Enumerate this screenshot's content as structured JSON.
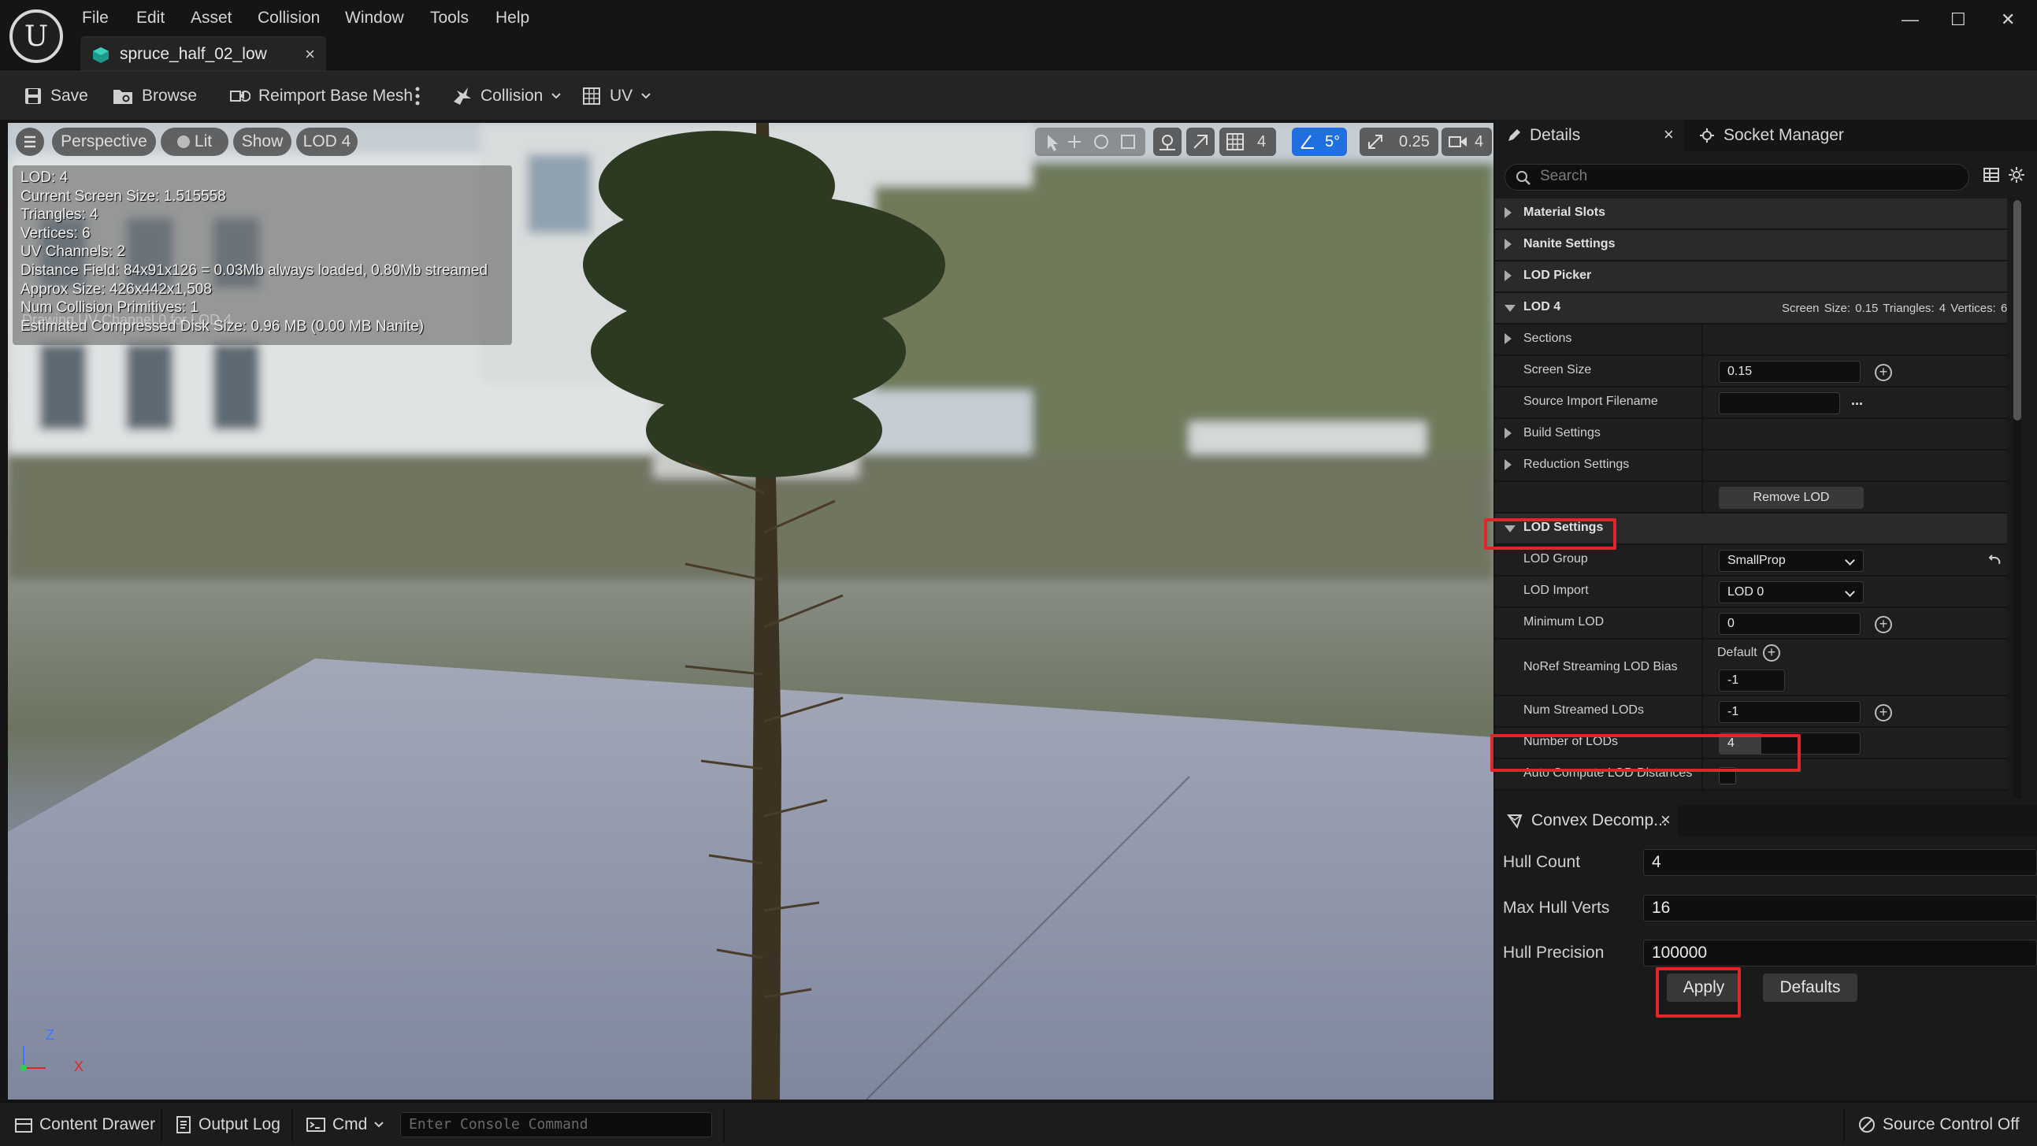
{
  "window": {
    "logo_text": "U",
    "menu": [
      "File",
      "Edit",
      "Asset",
      "Collision",
      "Window",
      "Tools",
      "Help"
    ],
    "tab_title": "spruce_half_02_low",
    "tab_close": "×",
    "minimize": "—",
    "maximize": "☐",
    "close": "✕"
  },
  "toolbar": {
    "save": "Save",
    "browse": "Browse",
    "reimport": "Reimport Base Mesh",
    "collision": "Collision",
    "uv": "UV"
  },
  "viewport": {
    "perspective": "Perspective",
    "lit": "Lit",
    "show": "Show",
    "lod": "LOD 4",
    "grid_value": "4",
    "angle_value": "5°",
    "scale_value": "0.25",
    "camera_speed": "4",
    "stats": [
      "LOD:  4",
      "Current Screen Size:  1.515558",
      "Triangles:  4",
      "Vertices:  6",
      "UV Channels:  2",
      "Distance Field:  84x91x126 = 0.03Mb always loaded, 0.80Mb streamed",
      "Approx Size: 426x442x1,508",
      "Num Collision Primitives:  1",
      "Estimated Compressed Disk Size: 0.96 MB (0.00 MB Nanite)"
    ],
    "ghost_text": "Drawing UV Channel 0 for LOD 4",
    "axis_z": "Z",
    "axis_x": "X"
  },
  "details": {
    "tab_details": "Details",
    "tab_close": "×",
    "tab_socket": "Socket Manager",
    "search_placeholder": "Search",
    "rows": {
      "material_slots": "Material Slots",
      "nanite_settings": "Nanite Settings",
      "lod_picker": "LOD Picker",
      "lod4": "LOD 4",
      "lod4_summary": "Screen Size: 0.15    Triangles: 4    Vertices: 6",
      "sections": "Sections",
      "screen_size": "Screen Size",
      "screen_size_value": "0.15",
      "source_import": "Source Import Filename",
      "source_import_dots": "...",
      "build_settings": "Build Settings",
      "reduction_settings": "Reduction Settings",
      "remove_lod": "Remove LOD",
      "lod_settings": "LOD Settings",
      "lod_group": "LOD Group",
      "lod_group_value": "SmallProp",
      "lod_import": "LOD Import",
      "lod_import_value": "LOD 0",
      "minimum_lod": "Minimum LOD",
      "minimum_lod_value": "0",
      "noref_bias": "NoRef Streaming LOD Bias",
      "noref_default": "Default",
      "noref_value": "-1",
      "num_streamed": "Num Streamed LODs",
      "num_streamed_value": "-1",
      "number_of_lods": "Number of LODs",
      "number_of_lods_value": "4",
      "number_of_lods_fill": 0.3,
      "auto_compute": "Auto Compute LOD Distances"
    }
  },
  "convex": {
    "title": "Convex Decomp...",
    "close": "×",
    "hull_count_label": "Hull Count",
    "hull_count_value": "4",
    "max_hull_verts_label": "Max Hull Verts",
    "max_hull_verts_value": "16",
    "max_hull_verts_fill": 0.22,
    "hull_precision_label": "Hull Precision",
    "hull_precision_value": "100000",
    "apply": "Apply",
    "defaults": "Defaults"
  },
  "statusbar": {
    "content_drawer": "Content Drawer",
    "output_log": "Output Log",
    "cmd": "Cmd",
    "console_placeholder": "Enter Console Command",
    "source_control": "Source Control Off"
  },
  "colors": {
    "highlight": "#e0262b",
    "accent_blue": "#1f6fe0"
  }
}
